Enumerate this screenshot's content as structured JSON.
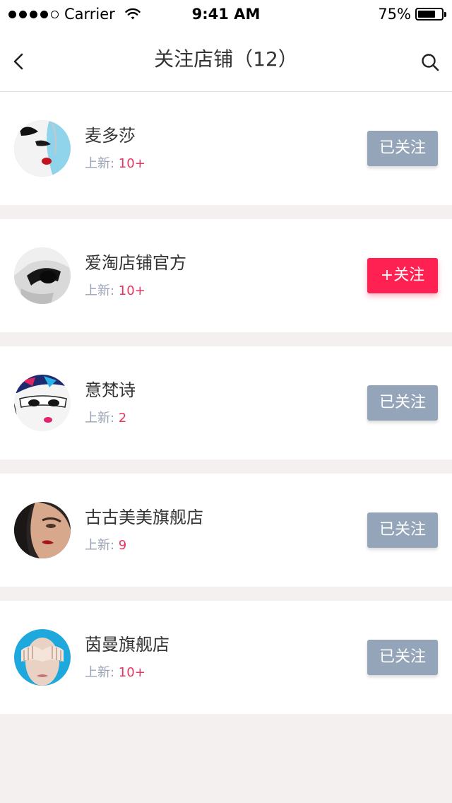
{
  "status_bar": {
    "carrier": "Carrier",
    "time": "9:41 AM",
    "battery": "75%",
    "battery_level": 0.75
  },
  "nav": {
    "title": "关注店铺（12）",
    "back_icon": "chevron-left-icon",
    "search_icon": "search-icon"
  },
  "update_label": "上新: ",
  "colors": {
    "followed_button": "#95a5b9",
    "follow_button": "#ff2152",
    "update_count": "#e8355f"
  },
  "stores": [
    {
      "name": "麦多莎",
      "update_count": "10+",
      "button_label": "已关注",
      "followed": true
    },
    {
      "name": "爱淘店铺官方",
      "update_count": "10+",
      "button_label": "+关注",
      "followed": false
    },
    {
      "name": "意梵诗",
      "update_count": "2",
      "button_label": "已关注",
      "followed": true
    },
    {
      "name": "古古美美旗舰店",
      "update_count": "9",
      "button_label": "已关注",
      "followed": true
    },
    {
      "name": "茵曼旗舰店",
      "update_count": "10+",
      "button_label": "已关注",
      "followed": true
    }
  ]
}
